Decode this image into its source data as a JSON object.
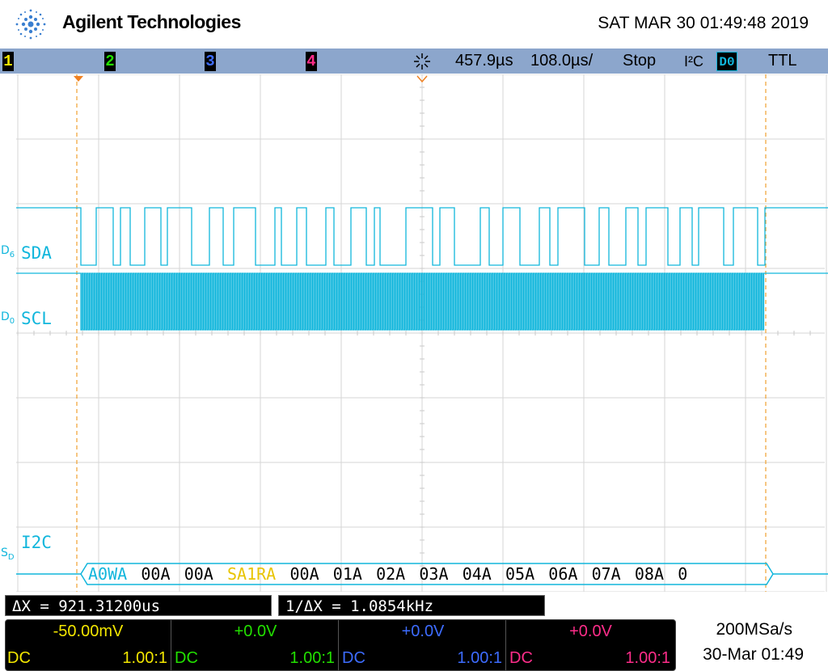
{
  "header": {
    "brand_name": "Agilent Technologies",
    "datetime": "SAT MAR 30 01:49:48 2019"
  },
  "statusbar": {
    "channels": [
      {
        "label": "1",
        "color": "#f2e600"
      },
      {
        "label": "2",
        "color": "#22e000"
      },
      {
        "label": "3",
        "color": "#3d6cff"
      },
      {
        "label": "4",
        "color": "#ff2d8a"
      }
    ],
    "trigger_time": "457.9µs",
    "timebase": "108.0µs/",
    "run_state": "Stop",
    "trigger_type": "I²C",
    "trigger_source": "D0",
    "threshold": "TTL"
  },
  "waveforms": {
    "sda_label": "SDA",
    "sda_channel": "D",
    "sda_channel_sub": "6",
    "scl_label": "SCL",
    "scl_channel": "D",
    "scl_channel_sub": "0",
    "bus_label": "I2C",
    "bus_channel": "S",
    "bus_channel_sub": "D",
    "color": "#11b6dc"
  },
  "decode": [
    {
      "text": "A0WA",
      "color": "#11b6dc"
    },
    {
      "text": "00A",
      "color": "#000000"
    },
    {
      "text": "00A",
      "color": "#000000"
    },
    {
      "text": "SA1RA",
      "color": "#e8c400"
    },
    {
      "text": "00A",
      "color": "#000000"
    },
    {
      "text": "01A",
      "color": "#000000"
    },
    {
      "text": "02A",
      "color": "#000000"
    },
    {
      "text": "03A",
      "color": "#000000"
    },
    {
      "text": "04A",
      "color": "#000000"
    },
    {
      "text": "05A",
      "color": "#000000"
    },
    {
      "text": "06A",
      "color": "#000000"
    },
    {
      "text": "07A",
      "color": "#000000"
    },
    {
      "text": "08A",
      "color": "#000000"
    },
    {
      "text": "0",
      "color": "#000000"
    }
  ],
  "readouts": {
    "delta_x": "ΔX = 921.31200us",
    "inv_delta_x": "1/ΔX = 1.0854kHz"
  },
  "channel_setup": [
    {
      "value": "-50.00mV",
      "coupling": "DC",
      "probe": "1.00:1",
      "color": "#f2e600"
    },
    {
      "value": "+0.0V",
      "coupling": "DC",
      "probe": "1.00:1",
      "color": "#22e000"
    },
    {
      "value": "+0.0V",
      "coupling": "DC",
      "probe": "1.00:1",
      "color": "#3d6cff"
    },
    {
      "value": "+0.0V",
      "coupling": "DC",
      "probe": "1.00:1",
      "color": "#ff2d8a"
    }
  ],
  "acquisition": {
    "sample_rate": "200MSa/s",
    "date": "30-Mar 01:49"
  }
}
